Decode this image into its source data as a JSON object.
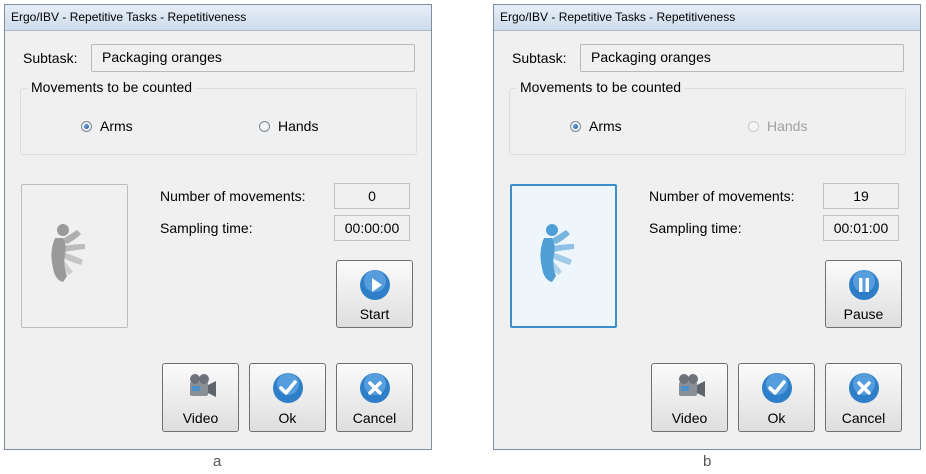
{
  "panels": [
    {
      "title": "Ergo/IBV - Repetitive Tasks - Repetitiveness",
      "subtask_label": "Subtask:",
      "subtask_value": "Packaging oranges",
      "group_title": "Movements to be counted",
      "radio_arms": "Arms",
      "radio_hands": "Hands",
      "selected": "Arms",
      "hands_enabled": true,
      "movements_label": "Number of movements:",
      "movements_value": "0",
      "sampling_label": "Sampling time:",
      "sampling_value": "00:00:00",
      "action_label": "Start",
      "action_icon": "play-icon",
      "video_label": "Video",
      "ok_label": "Ok",
      "cancel_label": "Cancel",
      "image_active": false,
      "caption": "a"
    },
    {
      "title": "Ergo/IBV - Repetitive Tasks - Repetitiveness",
      "subtask_label": "Subtask:",
      "subtask_value": "Packaging oranges",
      "group_title": "Movements to be counted",
      "radio_arms": "Arms",
      "radio_hands": "Hands",
      "selected": "Arms",
      "hands_enabled": false,
      "movements_label": "Number of movements:",
      "movements_value": "19",
      "sampling_label": "Sampling time:",
      "sampling_value": "00:01:00",
      "action_label": "Pause",
      "action_icon": "pause-icon",
      "video_label": "Video",
      "ok_label": "Ok",
      "cancel_label": "Cancel",
      "image_active": true,
      "caption": "b"
    }
  ],
  "colors": {
    "accent_blue": "#2f7fc8",
    "figure_inactive": "#9a9a9a",
    "figure_active": "#4f9fd6"
  }
}
